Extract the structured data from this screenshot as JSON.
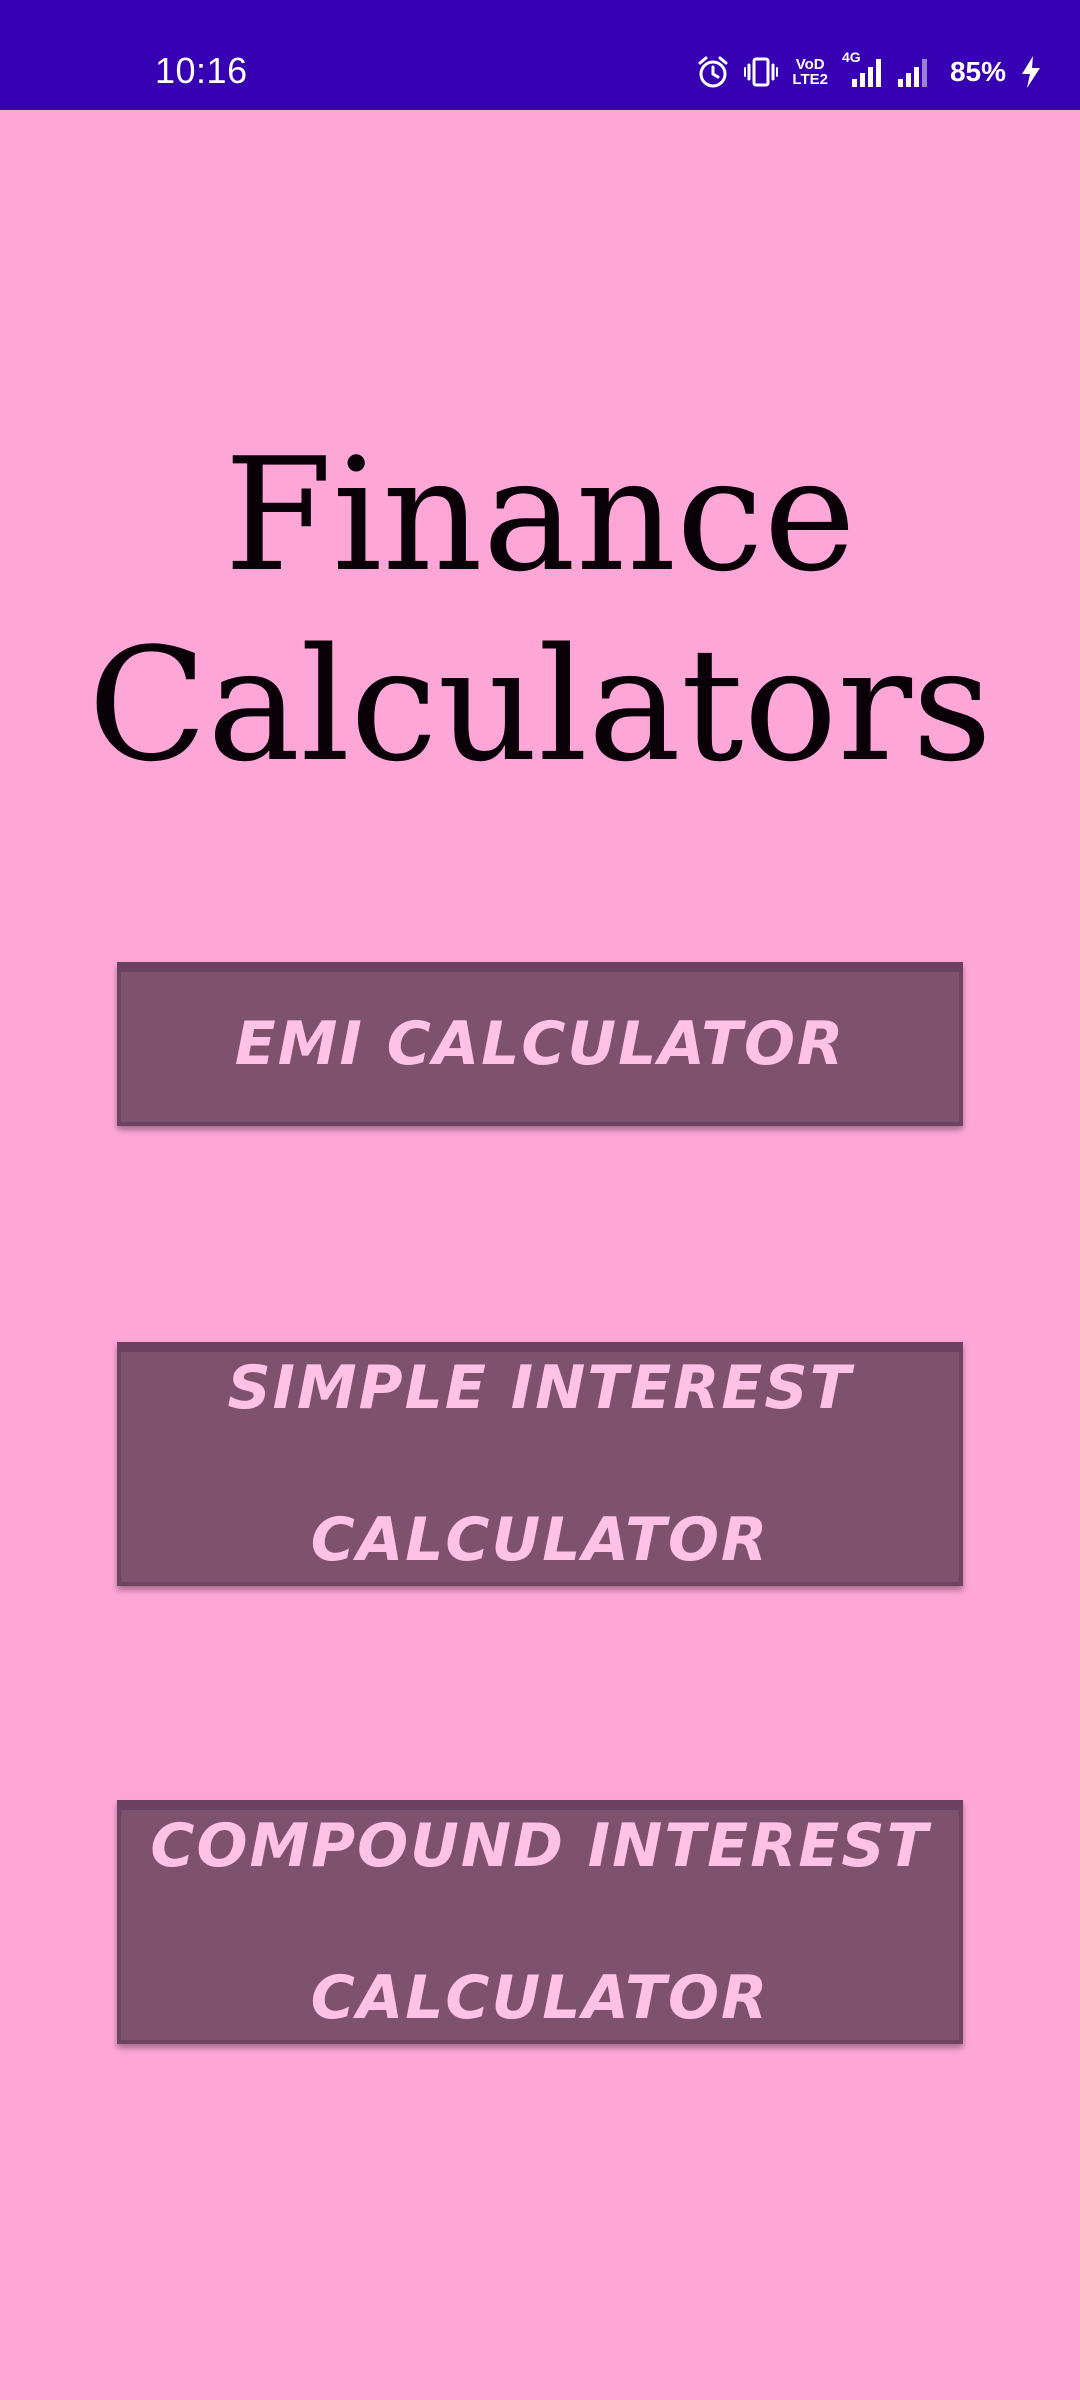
{
  "status_bar": {
    "time": "10:16",
    "network_label": "4G",
    "volte_line1": "VoD",
    "volte_line2": "LTE2",
    "battery": "85%",
    "colors": {
      "background": "#3700b3",
      "foreground": "#ffffff"
    },
    "icons": [
      "alarm-icon",
      "vibrate-icon",
      "volte-icon",
      "signal-icon",
      "signal-icon",
      "charging-icon"
    ]
  },
  "title": {
    "line1": "Finance",
    "line2": "Calculators"
  },
  "buttons": {
    "emi": "EMI CALCULATOR",
    "simple_line1": "SIMPLE INTEREST",
    "simple_line2": "CALCULATOR",
    "compound_line1": "COMPOUND INTEREST",
    "compound_line2": "CALCULATOR"
  },
  "colors": {
    "background": "#ffa6d9",
    "button_fill": "#7e526d",
    "button_text": "#ffc2e6",
    "title_text": "#0a0008"
  }
}
